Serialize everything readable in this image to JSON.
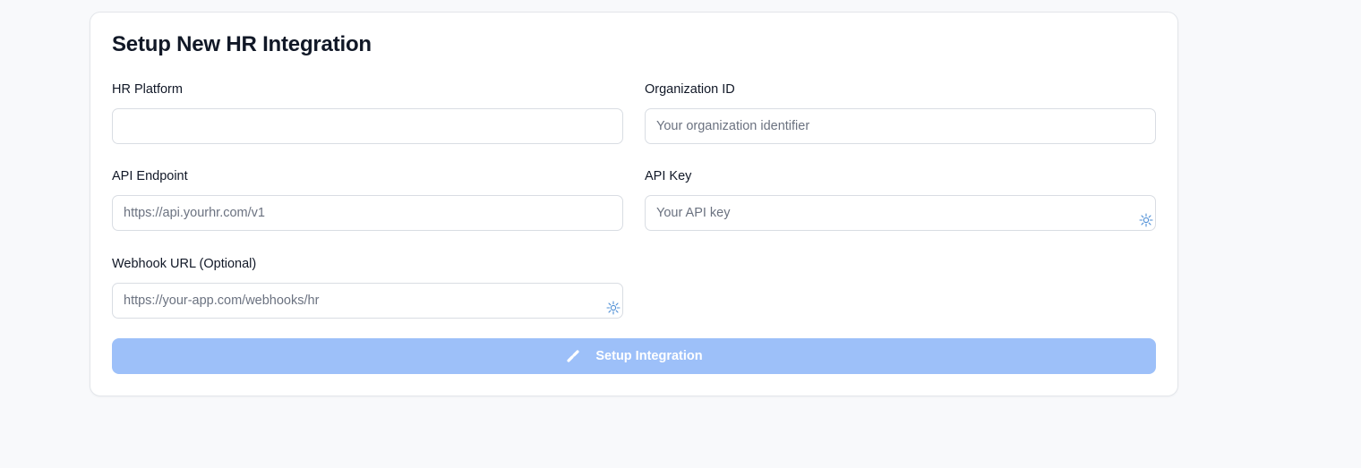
{
  "form": {
    "title": "Setup New HR Integration",
    "fields": {
      "hr_platform": {
        "label": "HR Platform",
        "value": "",
        "placeholder": ""
      },
      "organization_id": {
        "label": "Organization ID",
        "value": "",
        "placeholder": "Your organization identifier"
      },
      "api_endpoint": {
        "label": "API Endpoint",
        "value": "",
        "placeholder": "https://api.yourhr.com/v1"
      },
      "api_key": {
        "label": "API Key",
        "value": "",
        "placeholder": "Your API key",
        "icon": "password-manager-icon"
      },
      "webhook_url": {
        "label": "Webhook URL (Optional)",
        "value": "",
        "placeholder": "https://your-app.com/webhooks/hr",
        "icon": "password-manager-icon"
      }
    },
    "submit": {
      "label": "Setup Integration",
      "icon": "link-icon",
      "disabled": true,
      "color": "#9dc0f9"
    }
  }
}
